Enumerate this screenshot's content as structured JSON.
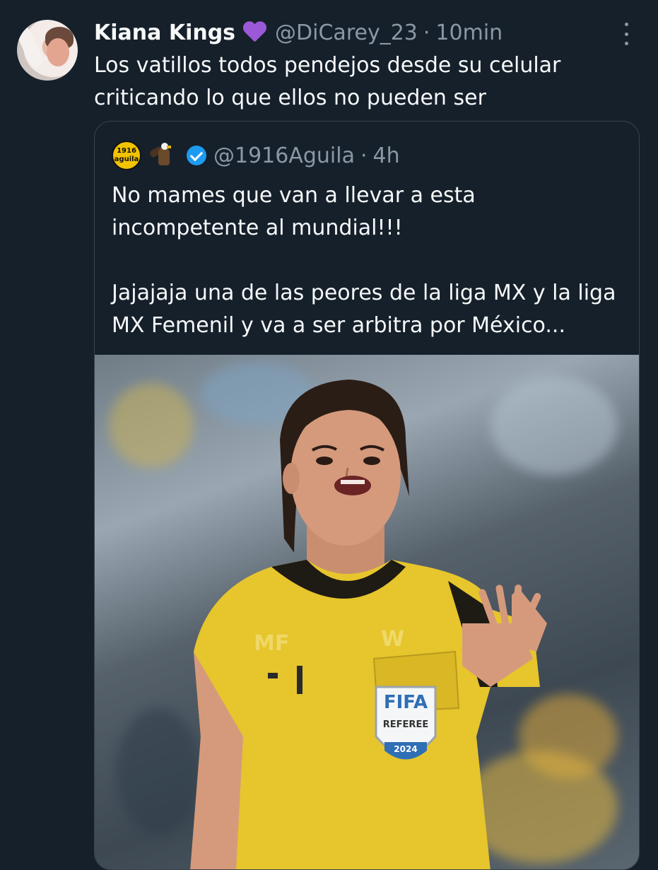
{
  "tweet": {
    "display_name": "Kiana Kings",
    "handle": "@DiCarey_23",
    "separator": "·",
    "time": "10min",
    "text": "Los vatillos todos pendejos desde su celular criticando lo que ellos no pueden ser",
    "icons": {
      "badge": "purple-heart-icon",
      "menu": "more-options-icon"
    },
    "badge_color": "#9b59d8"
  },
  "quoted_tweet": {
    "avatar_text_top": "1916",
    "avatar_text_bottom": "aguila",
    "handle": "@1916Aguila",
    "separator": "·",
    "time": "4h",
    "text": "No mames que van a llevar a esta incompetente al mundial!!!\n\nJajajaja una de las peores de la liga MX y la liga MX Femenil y va a ser arbitra por México...",
    "icons": {
      "emoji": "eagle-icon",
      "verified": "verified-badge-icon"
    },
    "verified_color": "#1d9bf0",
    "media": {
      "sleeve_text": "MF",
      "brand_text": "W",
      "patch_title": "FIFA",
      "patch_subtitle": "REFEREE",
      "patch_year": "2024"
    }
  },
  "theme": {
    "background": "#15202b",
    "text_primary": "#f7f9f9",
    "text_secondary": "#8b98a5",
    "border": "#38444d"
  }
}
